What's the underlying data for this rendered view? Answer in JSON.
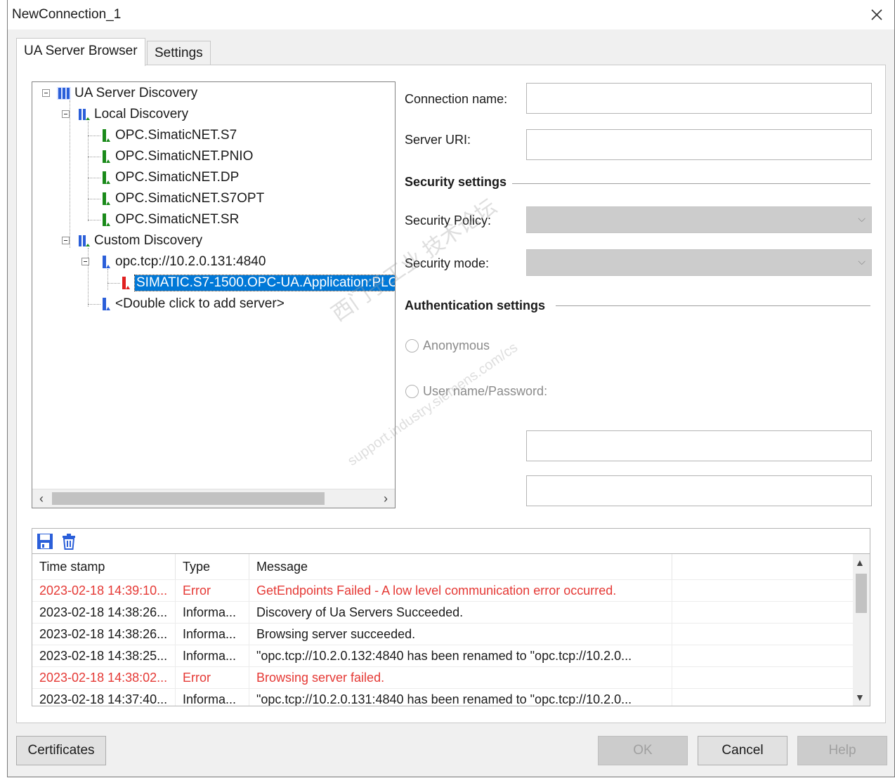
{
  "window": {
    "title": "NewConnection_1"
  },
  "tabs": [
    {
      "label": "UA Server Browser"
    },
    {
      "label": "Settings"
    }
  ],
  "tree": {
    "root": "UA Server Discovery",
    "local": "Local Discovery",
    "local_servers": [
      "OPC.SimaticNET.S7",
      "OPC.SimaticNET.PNIO",
      "OPC.SimaticNET.DP",
      "OPC.SimaticNET.S7OPT",
      "OPC.SimaticNET.SR"
    ],
    "custom": "Custom Discovery",
    "custom_server": "opc.tcp://10.2.0.131:4840",
    "selected_app": "SIMATIC.S7-1500.OPC-UA.Application:PLC",
    "add_server": "<Double click to add server>"
  },
  "form": {
    "connection_name_label": "Connection name:",
    "connection_name_value": "",
    "server_uri_label": "Server URI:",
    "server_uri_value": "",
    "security_settings": "Security settings",
    "security_policy_label": "Security Policy:",
    "security_mode_label": "Security mode:",
    "authentication_settings": "Authentication settings",
    "anonymous_label": "Anonymous",
    "userpass_label": "User name/Password:"
  },
  "watermark": {
    "line1": "西门子工业 技术论坛",
    "line2": "support.industry.siemens.com/cs"
  },
  "log": {
    "columns": [
      "Time stamp",
      "Type",
      "Message"
    ],
    "rows": [
      {
        "time": "2023-02-18 14:39:10...",
        "type": "Error",
        "message": "GetEndpoints Failed - A low level communication error occurred.",
        "level": "error"
      },
      {
        "time": "2023-02-18 14:38:26...",
        "type": "Informa...",
        "message": "Discovery of Ua Servers Succeeded.",
        "level": "info"
      },
      {
        "time": "2023-02-18 14:38:26...",
        "type": "Informa...",
        "message": "Browsing server succeeded.",
        "level": "info"
      },
      {
        "time": "2023-02-18 14:38:25...",
        "type": "Informa...",
        "message": "\"opc.tcp://10.2.0.132:4840 has been renamed to \"opc.tcp://10.2.0...",
        "level": "info"
      },
      {
        "time": "2023-02-18 14:38:02...",
        "type": "Error",
        "message": "Browsing server failed.",
        "level": "error"
      },
      {
        "time": "2023-02-18 14:37:40...",
        "type": "Informa...",
        "message": "\"opc.tcp://10.2.0.131:4840 has been renamed to \"opc.tcp://10.2.0...",
        "level": "info"
      }
    ]
  },
  "buttons": {
    "certificates": "Certificates",
    "ok": "OK",
    "cancel": "Cancel",
    "help": "Help"
  },
  "colors": {
    "selection": "#0078d7",
    "error_text": "#e53935",
    "icon_blue": "#2b5fd9",
    "icon_green": "#1a8a1a",
    "icon_red": "#e02020"
  }
}
